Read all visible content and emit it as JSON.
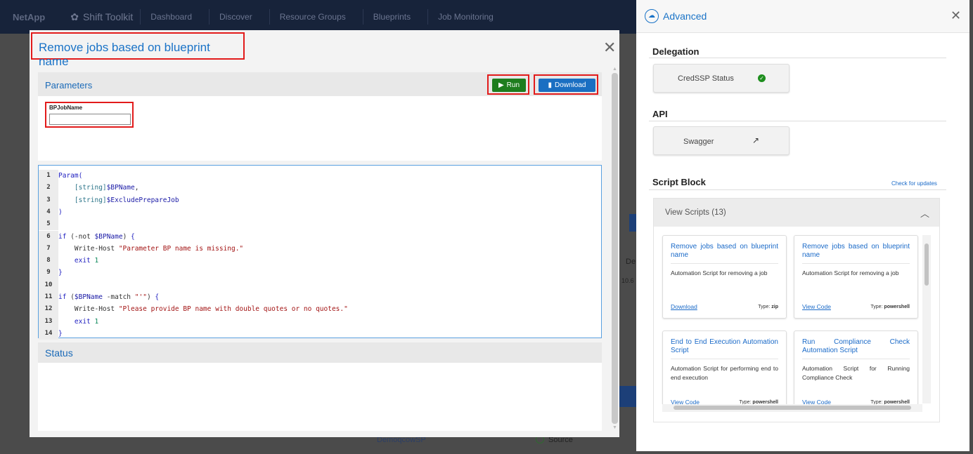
{
  "topnav": {
    "logo": "NetApp",
    "brand": "Shift Toolkit",
    "items": [
      "Dashboard",
      "Discover",
      "Resource Groups",
      "Blueprints",
      "Job Monitoring"
    ]
  },
  "background": {
    "label_partial": "De",
    "ip_partial": "10.6",
    "row_name": "DemoqcowSP",
    "row_role": "Source"
  },
  "modal": {
    "title": "Remove jobs based on blueprint name",
    "parameters_label": "Parameters",
    "run_label": "Run",
    "download_label": "Download",
    "param_name": "BPJobName",
    "param_value": "",
    "status_label": "Status",
    "code": [
      {
        "n": "1",
        "html": "<span class='kw'>Param(</span>"
      },
      {
        "n": "2",
        "html": "    <span class='tp'>[string]</span><span class='var'>$BPName</span><span class='cmd'>,</span>"
      },
      {
        "n": "3",
        "html": "    <span class='tp'>[string]</span><span class='var'>$ExcludePrepareJob</span>"
      },
      {
        "n": "4",
        "html": "<span class='kw'>)</span>"
      },
      {
        "n": "5",
        "html": ""
      },
      {
        "n": "6",
        "html": "<span class='kw'>if</span> <span class='cmd'>(-not</span> <span class='var'>$BPName</span><span class='cmd'>)</span> <span class='kw'>{</span>"
      },
      {
        "n": "7",
        "html": "    <span class='cmd'>Write-Host</span> <span class='str'>\"Parameter BP name is missing.\"</span>"
      },
      {
        "n": "8",
        "html": "    <span class='kw'>exit</span> <span class='num'>1</span>"
      },
      {
        "n": "9",
        "html": "<span class='kw'>}</span>"
      },
      {
        "n": "10",
        "html": ""
      },
      {
        "n": "11",
        "html": "<span class='kw'>if</span> <span class='cmd'>(</span><span class='var'>$BPName</span> <span class='cmd'>-match</span> <span class='str'>\"'\"</span><span class='cmd'>)</span> <span class='kw'>{</span>"
      },
      {
        "n": "12",
        "html": "    <span class='cmd'>Write-Host</span> <span class='str'>\"Please provide BP name with double quotes or no quotes.\"</span>"
      },
      {
        "n": "13",
        "html": "    <span class='kw'>exit</span> <span class='num'>1</span>"
      },
      {
        "n": "14",
        "html": "<span class='kw'>}</span>"
      }
    ]
  },
  "panel": {
    "title": "Advanced",
    "delegation": "Delegation",
    "credssp": "CredSSP Status",
    "api": "API",
    "swagger": "Swagger",
    "script_block": "Script Block",
    "check_updates": "Check for updates",
    "view_scripts": "View Scripts (13)",
    "type_prefix": "Type:",
    "cards": [
      {
        "title": "Remove jobs based on blueprint name",
        "desc": "Automation Script for removing a job",
        "link": "Download",
        "type": "zip"
      },
      {
        "title": "Remove jobs based on blueprint name",
        "desc": "Automation Script for removing a job",
        "link": "View Code",
        "type": "powershell"
      },
      {
        "title": "End to End Execution Automation Script",
        "desc": "Automation Script for performing end to end execution",
        "link": "View Code",
        "type": "powershell"
      },
      {
        "title": "Run Compliance Check Automation Script",
        "desc": "Automation Script for Running Compliance Check",
        "link": "View Code",
        "type": "powershell"
      }
    ]
  },
  "colors": {
    "accent": "#1a73c7",
    "run": "#1e7d1e",
    "download": "#1a6fc2",
    "highlight": "#e21b1b",
    "success": "#1e8e1e"
  }
}
